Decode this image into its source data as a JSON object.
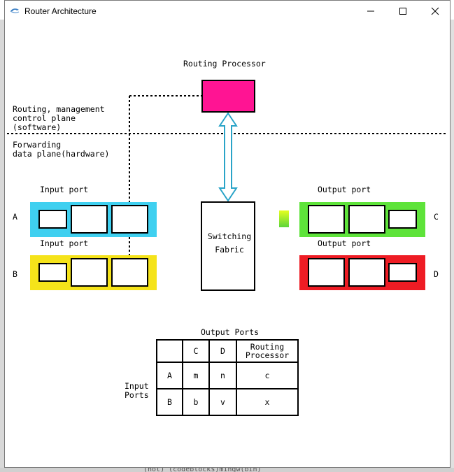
{
  "window": {
    "title": "Router Architecture"
  },
  "diagram": {
    "routing_processor_label": "Routing Processor",
    "control_plane_lines": [
      "Routing, management",
      "control plane",
      "(software)"
    ],
    "data_plane_lines": [
      "Forwarding",
      "data plane(hardware)"
    ],
    "input_port_label_a": "Input port",
    "input_port_label_b": "Input port",
    "output_port_label_c": "Output port",
    "output_port_label_d": "Output port",
    "port_letters": {
      "a": "A",
      "b": "B",
      "c": "C",
      "d": "D"
    },
    "switching_fabric_lines": [
      "Switching",
      "Fabric"
    ],
    "colors": {
      "routing_processor": "#ff1493",
      "port_a": "#3fd0f0",
      "port_b": "#f5e31a",
      "port_c": "#5ee33a",
      "port_d": "#ee1c24",
      "arrow": "#2aa4c8"
    }
  },
  "table": {
    "caption": "Output Ports",
    "row_header_lines": [
      "Input",
      "Ports"
    ],
    "columns": [
      "",
      "C",
      "D",
      "Routing\nProcessor"
    ],
    "column_c": "C",
    "column_d": "D",
    "column_rp_lines": [
      "Routing",
      "Processor"
    ],
    "rows": [
      {
        "input": "A",
        "c": "m",
        "d": "n",
        "rp": "c"
      },
      {
        "input": "B",
        "c": "b",
        "d": "v",
        "rp": "x"
      }
    ]
  },
  "background": {
    "partial_text": "(not) (codeblocks)mingw(bin)"
  }
}
